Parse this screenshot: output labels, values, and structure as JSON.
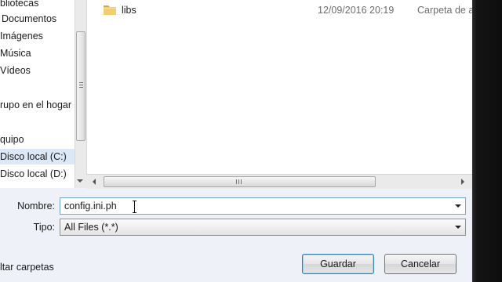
{
  "nav": {
    "items": [
      {
        "label": "bliotecas"
      },
      {
        "label": "Documentos"
      },
      {
        "label": "Imágenes"
      },
      {
        "label": "Música"
      },
      {
        "label": "Vídeos"
      },
      {
        "label": "rupo en el hogar"
      },
      {
        "label": "quipo"
      },
      {
        "label": "Disco local (C:)",
        "selected": true
      },
      {
        "label": "Disco local (D:)"
      }
    ]
  },
  "files": [
    {
      "name": "libs",
      "date": "12/09/2016 20:19",
      "type": "Carpeta de a",
      "icon": "folder-icon"
    }
  ],
  "form": {
    "name_label": "Nombre:",
    "name_value": "config.ini.ph",
    "type_label": "Tipo:",
    "type_value": "All Files (*.*)"
  },
  "footer": {
    "hide_folders": "ltar carpetas",
    "save_label": "Guardar",
    "cancel_label": "Cancelar"
  },
  "colors": {
    "selection": "#dde8f6",
    "folder": "#e8c05a"
  }
}
